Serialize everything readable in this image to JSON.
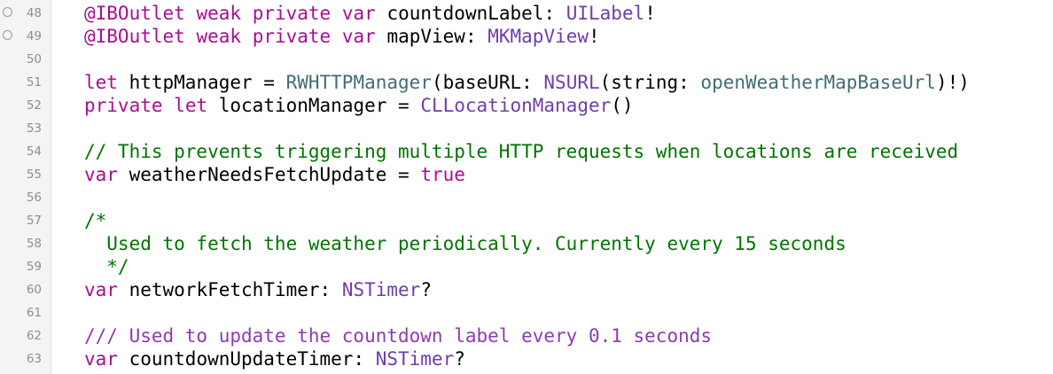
{
  "editor": {
    "colors": {
      "gutter_bg": "#f4f4f4",
      "line_number": "#8e8e8e",
      "keyword": "#aa0d91",
      "attribute": "#836c28",
      "type": "#703daa",
      "project_symbol": "#3f6e74",
      "comment": "#007400",
      "doc_comment": "#8d3bb1",
      "plain": "#000000"
    },
    "lines": [
      {
        "number": "48",
        "outlet": true,
        "tokens": [
          {
            "t": "@IBOutlet",
            "k": "keyword"
          },
          {
            "t": " ",
            "k": "plain"
          },
          {
            "t": "weak",
            "k": "keyword"
          },
          {
            "t": " ",
            "k": "plain"
          },
          {
            "t": "private",
            "k": "keyword"
          },
          {
            "t": " ",
            "k": "plain"
          },
          {
            "t": "var",
            "k": "keyword"
          },
          {
            "t": " countdownLabel: ",
            "k": "plain"
          },
          {
            "t": "UILabel",
            "k": "type"
          },
          {
            "t": "!",
            "k": "plain"
          }
        ]
      },
      {
        "number": "49",
        "outlet": true,
        "tokens": [
          {
            "t": "@IBOutlet",
            "k": "keyword"
          },
          {
            "t": " ",
            "k": "plain"
          },
          {
            "t": "weak",
            "k": "keyword"
          },
          {
            "t": " ",
            "k": "plain"
          },
          {
            "t": "private",
            "k": "keyword"
          },
          {
            "t": " ",
            "k": "plain"
          },
          {
            "t": "var",
            "k": "keyword"
          },
          {
            "t": " mapView: ",
            "k": "plain"
          },
          {
            "t": "MKMapView",
            "k": "type"
          },
          {
            "t": "!",
            "k": "plain"
          }
        ]
      },
      {
        "number": "50",
        "outlet": false,
        "tokens": []
      },
      {
        "number": "51",
        "outlet": false,
        "tokens": [
          {
            "t": "let",
            "k": "keyword"
          },
          {
            "t": " httpManager = ",
            "k": "plain"
          },
          {
            "t": "RWHTTPManager",
            "k": "project"
          },
          {
            "t": "(baseURL: ",
            "k": "plain"
          },
          {
            "t": "NSURL",
            "k": "type"
          },
          {
            "t": "(string: ",
            "k": "plain"
          },
          {
            "t": "openWeatherMapBaseUrl",
            "k": "project"
          },
          {
            "t": ")!)",
            "k": "plain"
          }
        ]
      },
      {
        "number": "52",
        "outlet": false,
        "tokens": [
          {
            "t": "private",
            "k": "keyword"
          },
          {
            "t": " ",
            "k": "plain"
          },
          {
            "t": "let",
            "k": "keyword"
          },
          {
            "t": " locationManager = ",
            "k": "plain"
          },
          {
            "t": "CLLocationManager",
            "k": "type"
          },
          {
            "t": "()",
            "k": "plain"
          }
        ]
      },
      {
        "number": "53",
        "outlet": false,
        "tokens": []
      },
      {
        "number": "54",
        "outlet": false,
        "tokens": [
          {
            "t": "// This prevents triggering multiple HTTP requests when locations are received",
            "k": "comment"
          }
        ]
      },
      {
        "number": "55",
        "outlet": false,
        "tokens": [
          {
            "t": "var",
            "k": "keyword"
          },
          {
            "t": " weatherNeedsFetchUpdate = ",
            "k": "plain"
          },
          {
            "t": "true",
            "k": "keyword"
          }
        ]
      },
      {
        "number": "56",
        "outlet": false,
        "tokens": []
      },
      {
        "number": "57",
        "outlet": false,
        "tokens": [
          {
            "t": "/*",
            "k": "comment"
          }
        ]
      },
      {
        "number": "58",
        "outlet": false,
        "tokens": [
          {
            "t": "  Used to fetch the weather periodically. Currently every 15 seconds",
            "k": "comment"
          }
        ]
      },
      {
        "number": "59",
        "outlet": false,
        "tokens": [
          {
            "t": "  */",
            "k": "comment"
          }
        ]
      },
      {
        "number": "60",
        "outlet": false,
        "tokens": [
          {
            "t": "var",
            "k": "keyword"
          },
          {
            "t": " networkFetchTimer: ",
            "k": "plain"
          },
          {
            "t": "NSTimer",
            "k": "type"
          },
          {
            "t": "?",
            "k": "plain"
          }
        ]
      },
      {
        "number": "61",
        "outlet": false,
        "tokens": []
      },
      {
        "number": "62",
        "outlet": false,
        "tokens": [
          {
            "t": "/// Used to update the countdown label every 0.1 seconds",
            "k": "doc"
          }
        ]
      },
      {
        "number": "63",
        "outlet": false,
        "tokens": [
          {
            "t": "var",
            "k": "keyword"
          },
          {
            "t": " countdownUpdateTimer: ",
            "k": "plain"
          },
          {
            "t": "NSTimer",
            "k": "type"
          },
          {
            "t": "?",
            "k": "plain"
          }
        ]
      }
    ]
  }
}
